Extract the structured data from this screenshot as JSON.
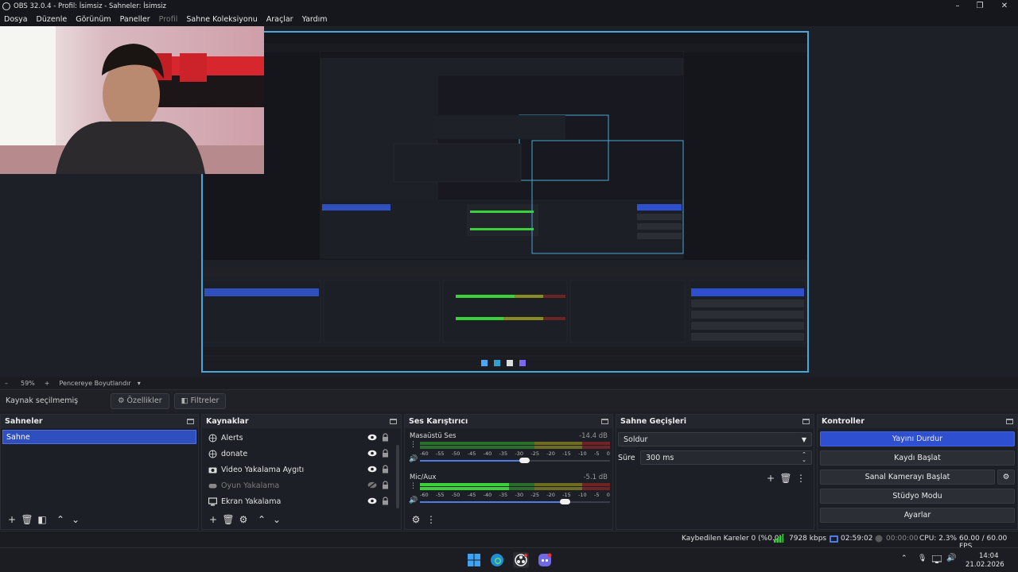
{
  "window": {
    "title": "OBS 32.0.4 - Profil: İsimsiz - Sahneler: İsimsiz",
    "minimize": "–",
    "maximize": "❐",
    "close": "✕"
  },
  "menu": [
    "Dosya",
    "Düzenle",
    "Görünüm",
    "Paneller",
    "Profil",
    "Sahne Koleksiyonu",
    "Araçlar",
    "Yardım"
  ],
  "zoom": {
    "minus": "–",
    "value": "59%",
    "plus": "+",
    "fit_label": "Pencereye Boyutlandır"
  },
  "source_toolbar": {
    "no_source": "Kaynak seçilmemiş",
    "properties": "Özellikler",
    "filters": "Filtreler"
  },
  "scenes": {
    "title": "Sahneler",
    "items": [
      "Sahne"
    ]
  },
  "sources": {
    "title": "Kaynaklar",
    "items": [
      {
        "label": "Alerts",
        "icon": "globe-icon",
        "visible": true
      },
      {
        "label": "donate",
        "icon": "globe-icon",
        "visible": true
      },
      {
        "label": "Video Yakalama Aygıtı",
        "icon": "camera-icon",
        "visible": true
      },
      {
        "label": "Oyun Yakalama",
        "icon": "gamepad-icon",
        "visible": false
      },
      {
        "label": "Ekran Yakalama",
        "icon": "monitor-icon",
        "visible": true
      }
    ]
  },
  "mixer": {
    "title": "Ses Karıştırıcı",
    "ticks": [
      "-60",
      "-55",
      "-50",
      "-45",
      "-40",
      "-35",
      "-30",
      "-25",
      "-20",
      "-15",
      "-10",
      "-5",
      "0"
    ],
    "channels": [
      {
        "name": "Masaüstü Ses",
        "db": "-14.4 dB",
        "level": 0.0,
        "volume": 0.55
      },
      {
        "name": "Mic/Aux",
        "db": "-5.1 dB",
        "level": 0.47,
        "volume": 0.76
      }
    ]
  },
  "transitions": {
    "title": "Sahne Geçişleri",
    "selected": "Soldur",
    "duration_label": "Süre",
    "duration_value": "300 ms"
  },
  "controls": {
    "title": "Kontroller",
    "buttons": [
      "Yayını Durdur",
      "Kaydı Başlat",
      "Sanal Kamerayı Başlat",
      "Stüdyo Modu",
      "Ayarlar"
    ]
  },
  "status": {
    "dropped": "Kaybedilen Kareler 0 (%0.0)",
    "bitrate": "7928 kbps",
    "stream_time": "02:59:02",
    "rec_time": "00:00:00",
    "cpu": "CPU: 2.3%",
    "fps": "60.00 / 60.00 FPS"
  },
  "taskbar": {
    "time": "14:04",
    "date": "21.02.2026"
  },
  "colors": {
    "accent": "#2e4fd0",
    "preview_border": "#4aa6d6",
    "meter_green": "#3ad13a",
    "meter_yellow": "#c9c024",
    "meter_red": "#c83232"
  }
}
